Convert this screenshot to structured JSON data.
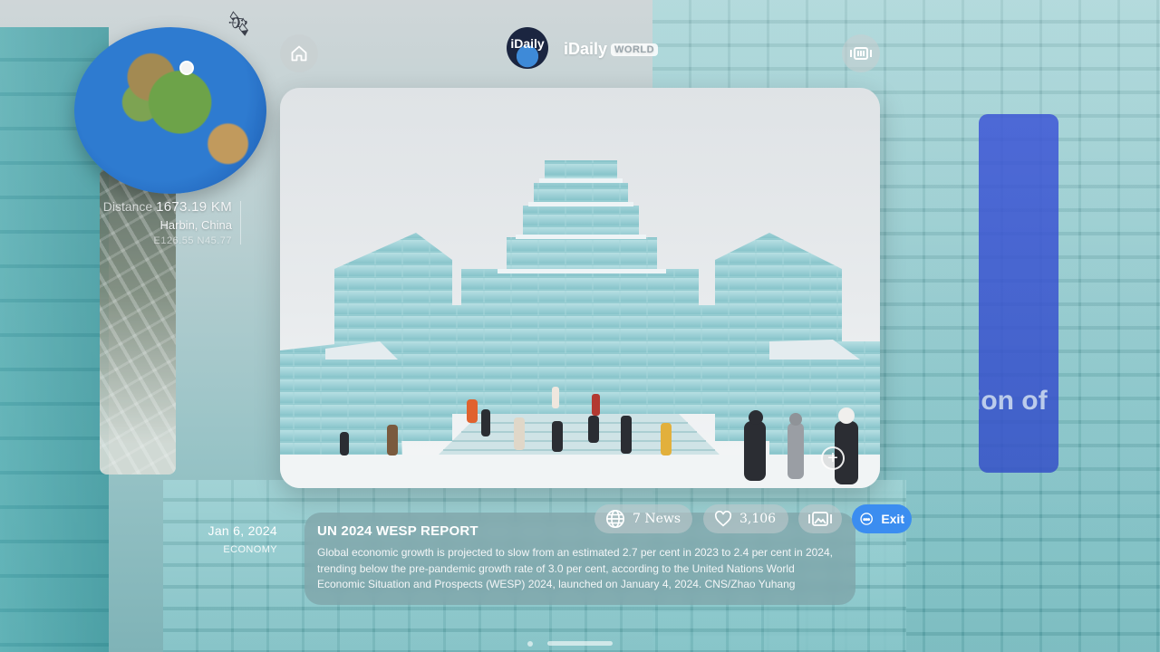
{
  "header": {
    "logo_text": "iDaily",
    "brand_name": "iDaily",
    "brand_badge": "WORLD"
  },
  "location": {
    "distance_label": "Distance",
    "distance_value": "1673.19 KM",
    "city": "Harbin, China",
    "coordinates": "E126.55 N45.77"
  },
  "article": {
    "date": "Jan 6, 2024",
    "category": "ECONOMY",
    "title": "UN 2024 WESP REPORT",
    "body": "Global economic growth is projected to slow from an estimated 2.7 per cent in 2023 to 2.4 per cent in 2024, trending below the pre-pandemic growth rate of 3.0 per cent, according to the United Nations World Economic Situation and Prospects (WESP) 2024, launched on January 4, 2024. CNS/Zhao Yuhang"
  },
  "actions": {
    "news_label": "7 News",
    "likes_count": "3,106",
    "exit_label": "Exit"
  },
  "background": {
    "banner_text": "tion of"
  },
  "colors": {
    "accent": "#3b8df0",
    "banner": "#3550c8",
    "ice": "#8fd0d3"
  },
  "icons": {
    "home": "home-icon",
    "immersive": "immersive-mode-icon",
    "globe": "globe-icon",
    "heart": "heart-icon",
    "gallery": "gallery-icon",
    "exit": "exit-icon",
    "zoom": "zoom-icon",
    "satellite": "satellite-icon"
  }
}
